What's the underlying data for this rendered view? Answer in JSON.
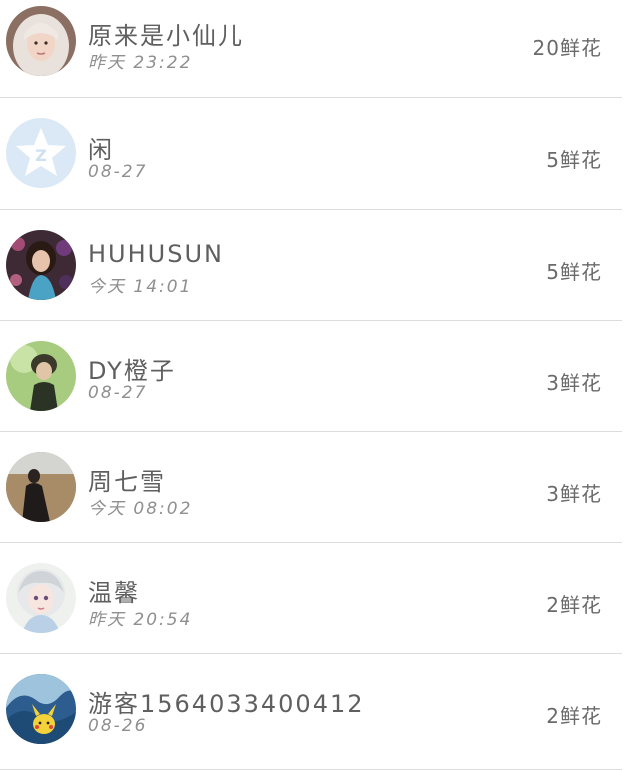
{
  "rows": [
    {
      "name": "原来是小仙儿",
      "time": "昨天 23:22",
      "flowers": "20鲜花",
      "avatar_icon": "girl-headscarf-avatar"
    },
    {
      "name": "闲",
      "time": "08-27",
      "flowers": "5鲜花",
      "avatar_icon": "qq-default-avatar"
    },
    {
      "name": "HUHUSUN",
      "time": "今天 14:01",
      "flowers": "5鲜花",
      "avatar_icon": "girl-flowers-avatar"
    },
    {
      "name": "DY橙子",
      "time": "08-27",
      "flowers": "3鲜花",
      "avatar_icon": "boy-green-avatar"
    },
    {
      "name": "周七雪",
      "time": "今天 08:02",
      "flowers": "3鲜花",
      "avatar_icon": "field-portrait-avatar"
    },
    {
      "name": "温馨",
      "time": "昨天 20:54",
      "flowers": "2鲜花",
      "avatar_icon": "anime-girl-avatar"
    },
    {
      "name": "游客1564033400412",
      "time": "08-26",
      "flowers": "2鲜花",
      "avatar_icon": "pikachu-wave-avatar"
    }
  ],
  "colors": {
    "divider": "#dcdcdc",
    "name_text": "#5f5f5f",
    "time_text": "#8f8f8f",
    "flower_text": "#6a6a6a",
    "qq_avatar_bg": "#dbe9f6"
  }
}
